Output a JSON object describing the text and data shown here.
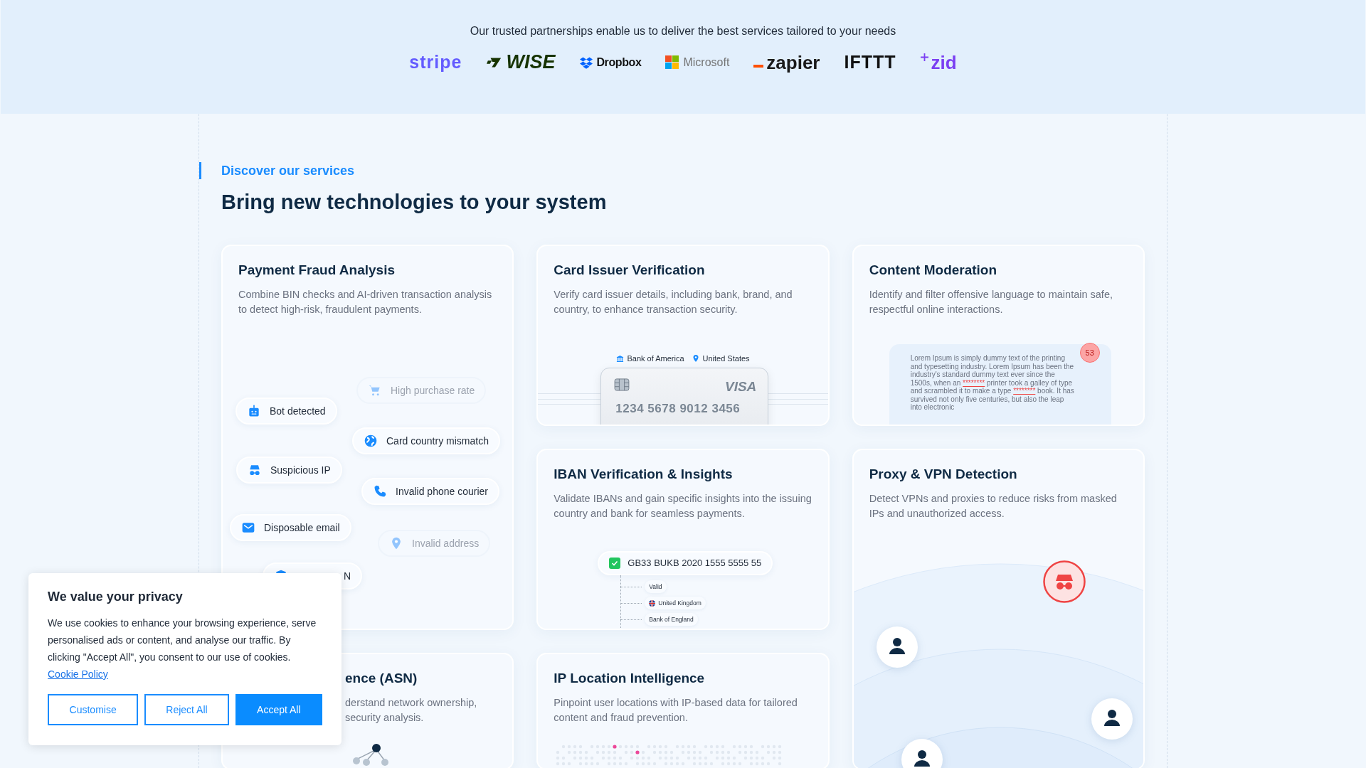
{
  "partners": {
    "tagline": "Our trusted partnerships enable us to deliver the best services tailored to your needs",
    "logos": [
      {
        "text": "stripe",
        "color": "#635bff",
        "kind": "plain"
      },
      {
        "text": "WISE",
        "color": "#163300",
        "kind": "flag"
      },
      {
        "text": "Dropbox",
        "color": "#111111",
        "kind": "box"
      },
      {
        "text": "Microsoft",
        "color": "#737373",
        "kind": "squares"
      },
      {
        "text": "zapier",
        "color": "#1a1a1a",
        "kind": "underscore"
      },
      {
        "text": "IFTTT",
        "color": "#111111",
        "kind": "plain"
      },
      {
        "text": "zid",
        "color": "#7b3ff2",
        "kind": "sparkle"
      }
    ]
  },
  "services": {
    "eyebrow": "Discover our services",
    "heading": "Bring new technologies to your system",
    "cards": [
      {
        "kind": "fraud",
        "title": "Payment Fraud Analysis",
        "description": "Combine BIN checks and AI-driven transaction analysis to detect high-risk, fraudulent payments.",
        "signals": [
          {
            "label": "High purchase rate",
            "kind": "cart",
            "faded": true
          },
          {
            "label": "Bot detected",
            "kind": "robot",
            "faded": false
          },
          {
            "label": "Card country mismatch",
            "kind": "globe",
            "faded": false
          },
          {
            "label": "Suspicious IP",
            "kind": "spy",
            "faded": false
          },
          {
            "label": "Invalid phone courier",
            "kind": "phone",
            "faded": false
          },
          {
            "label": "Disposable email",
            "kind": "mail",
            "faded": false
          },
          {
            "label": "Invalid address",
            "kind": "pin",
            "faded": true
          },
          {
            "label": "N",
            "kind": "shield",
            "faded": false
          }
        ]
      },
      {
        "kind": "issuer",
        "title": "Card Issuer Verification",
        "description": "Verify card issuer details, including bank, brand, and country, to enhance transaction security.",
        "bank": "Bank of America",
        "country": "United States",
        "brand": "VISA",
        "card_number": "1234 5678 9012 3456"
      },
      {
        "kind": "moderation",
        "title": "Content Moderation",
        "description": "Identify and filter offensive language to maintain safe, respectful online interactions.",
        "badge": "53",
        "segments": [
          {
            "text": "Lorem Ipsum is simply dummy text of the printing and typesetting industry. Lorem Ipsum has been the industry's standard dummy text ever since the 1500s, when an ",
            "flagged": false
          },
          {
            "text": "********",
            "flagged": true
          },
          {
            "text": " printer took a galley of type and scrambled it to make a type ",
            "flagged": false
          },
          {
            "text": "********",
            "flagged": true
          },
          {
            "text": " book. It has survived not only five centuries, but also the leap into electronic",
            "flagged": false
          }
        ]
      },
      {
        "kind": "iban",
        "title": "IBAN Verification & Insights",
        "description": "Validate IBANs and gain specific insights into the issuing country and bank for seamless payments.",
        "iban": "GB33 BUKB 2020 1555 5555 55",
        "valid": true,
        "details": [
          {
            "text": "Valid",
            "kind": "plain"
          },
          {
            "text": "United Kingdom",
            "kind": "flag"
          },
          {
            "text": "Bank of England",
            "kind": "plain"
          }
        ]
      },
      {
        "kind": "proxy",
        "title": "Proxy & VPN Detection",
        "description": "Detect VPNs and proxies to reduce risks from masked IPs and unauthorized access."
      },
      {
        "kind": "asn",
        "title": "ence (ASN)",
        "description": "derstand network ownership, security analysis."
      },
      {
        "kind": "location",
        "title": "IP Location Intelligence",
        "description": "Pinpoint user locations with IP-based data for tailored content and fraud prevention."
      }
    ]
  },
  "cookie_banner": {
    "title": "We value your privacy",
    "text": "We use cookies to enhance your browsing experience, serve personalised ads or content, and analyse our traffic. By clicking \"Accept All\", you consent to our use of cookies.",
    "link": "Cookie Policy",
    "buttons": [
      {
        "label": "Customise",
        "primary": false
      },
      {
        "label": "Reject All",
        "primary": false
      },
      {
        "label": "Accept All",
        "primary": true
      }
    ]
  }
}
